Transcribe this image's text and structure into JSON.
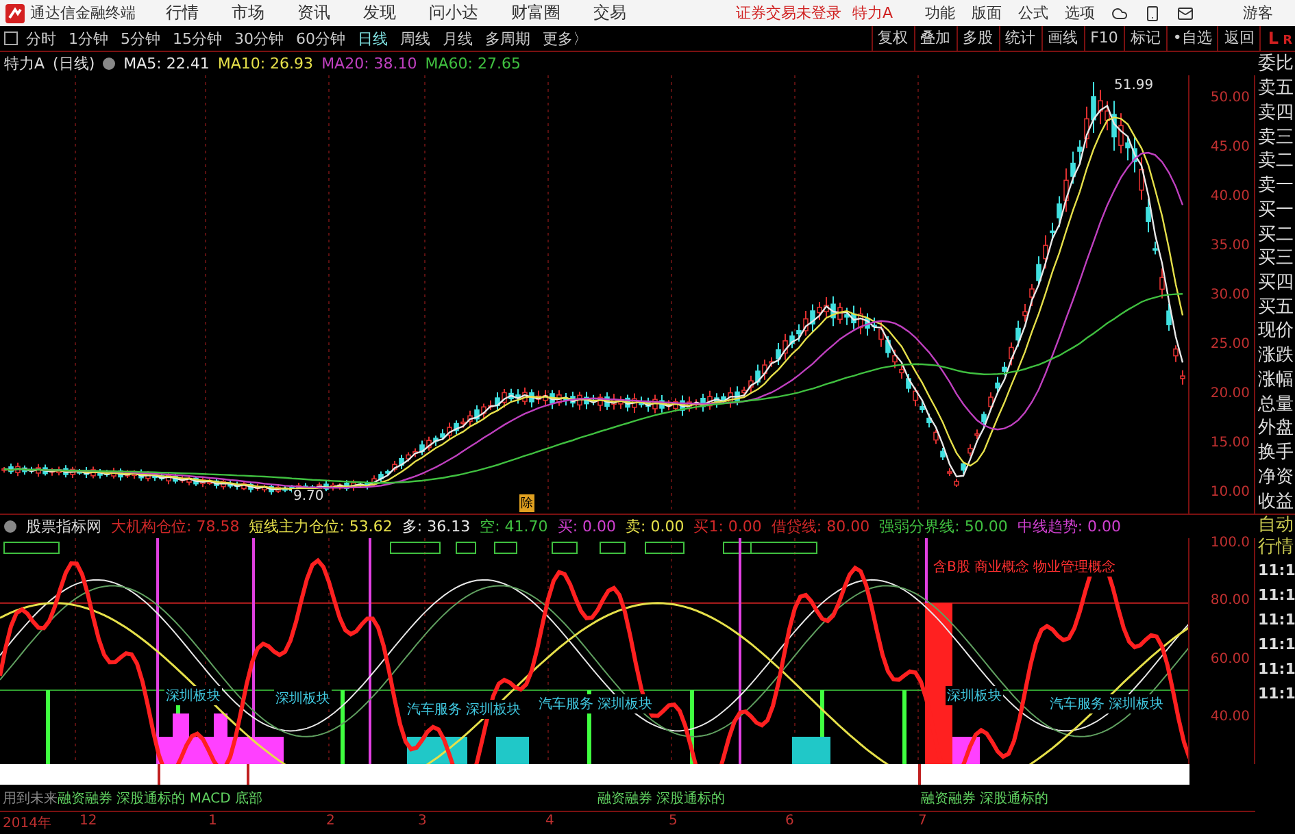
{
  "menubar": {
    "app_title": "通达信金融终端",
    "menus": [
      "行情",
      "市场",
      "资讯",
      "发现",
      "问小达",
      "财富圈",
      "交易"
    ],
    "login_status": "证券交易未登录",
    "stock": "特力A",
    "tools": [
      "功能",
      "版面",
      "公式",
      "选项"
    ],
    "user": "游客"
  },
  "toolbar": {
    "periods": [
      {
        "label": "分时",
        "selected": false
      },
      {
        "label": "1分钟",
        "selected": false
      },
      {
        "label": "5分钟",
        "selected": false
      },
      {
        "label": "15分钟",
        "selected": false
      },
      {
        "label": "30分钟",
        "selected": false
      },
      {
        "label": "60分钟",
        "selected": false
      },
      {
        "label": "日线",
        "selected": true
      },
      {
        "label": "周线",
        "selected": false
      },
      {
        "label": "月线",
        "selected": false
      },
      {
        "label": "多周期",
        "selected": false
      },
      {
        "label": "更多〉",
        "selected": false
      }
    ],
    "actions": [
      "复权",
      "叠加",
      "多股",
      "统计",
      "画线",
      "F10",
      "标记",
      "•自选",
      "返回"
    ],
    "panel_toggles": [
      "L",
      "R"
    ]
  },
  "ma_bar": {
    "stock": "特力A",
    "period": "(日线)",
    "averages": [
      {
        "label": "MA5: 22.41",
        "color": "#e8e8e8"
      },
      {
        "label": "MA10: 26.93",
        "color": "#e6e04a"
      },
      {
        "label": "MA20: 38.10",
        "color": "#c040c0"
      },
      {
        "label": "MA60: 27.65",
        "color": "#40c040"
      }
    ]
  },
  "price_chart": {
    "axis_labels": [
      "50.00",
      "45.00",
      "40.00",
      "35.00",
      "30.00",
      "25.00",
      "20.00",
      "15.00",
      "10.00"
    ],
    "high_label": "51.99",
    "low_label": "9.70",
    "event_marker": "除"
  },
  "quote_panel": {
    "labels": [
      "委比",
      "卖五",
      "卖四",
      "卖三",
      "卖二",
      "卖一",
      "买一",
      "买二",
      "买三",
      "买四",
      "买五",
      "现价",
      "涨跌",
      "涨幅",
      "总量",
      "外盘",
      "换手",
      "净资",
      "收益"
    ],
    "mode_labels": [
      "自动",
      "行情"
    ],
    "times": [
      "11:1",
      "11:1",
      "11:1",
      "11:1",
      "11:1",
      "11:1"
    ]
  },
  "indicator": {
    "name": "股票指标网",
    "readings": [
      {
        "label": "大机构仓位: 78.58",
        "color": "#d02828"
      },
      {
        "label": "短线主力仓位: 53.62",
        "color": "#e6e04a"
      },
      {
        "label": "多: 36.13",
        "color": "#e8e8e8"
      },
      {
        "label": "空: 41.70",
        "color": "#40c040"
      },
      {
        "label": "买: 0.00",
        "color": "#d040d0"
      },
      {
        "label": "卖: 0.00",
        "color": "#e6e04a"
      },
      {
        "label": "买1: 0.00",
        "color": "#d02828"
      },
      {
        "label": "借贷线: 80.00",
        "color": "#d02828"
      },
      {
        "label": "强弱分界线: 50.00",
        "color": "#40c040"
      },
      {
        "label": "中线趋势: 0.00",
        "color": "#d040d0"
      }
    ],
    "axis_labels": [
      "100.0",
      "80.00",
      "60.00",
      "40.00"
    ],
    "tags": [
      "深圳板块",
      "深圳板块",
      "汽车服务 深圳板块",
      "汽车服务 深圳板块",
      "深圳板块",
      "汽车服务 深圳板块",
      "含B股 商业概念 物业管理概念"
    ]
  },
  "signals_row": {
    "left_label": "用到未来",
    "tags": [
      "融资融券 深股通标的 MACD 底部",
      "融资融券 深股通标的",
      "融资融券 深股通标的"
    ]
  },
  "date_axis": [
    "2014年",
    "12",
    "1",
    "2",
    "3",
    "4",
    "5",
    "6",
    "7"
  ]
}
